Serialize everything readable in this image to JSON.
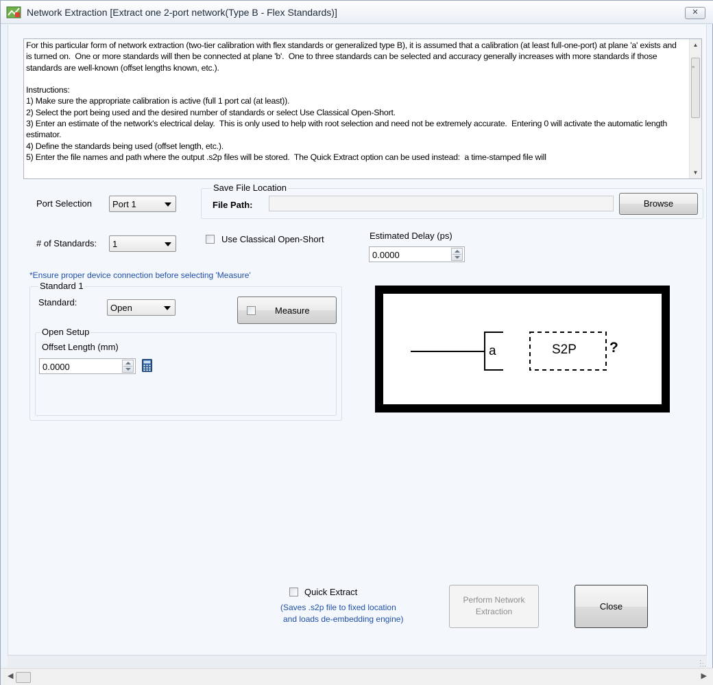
{
  "window": {
    "title": "Network Extraction [Extract one 2-port network(Type B - Flex Standards)]",
    "close_glyph": "☒"
  },
  "instructions": {
    "text": "For this particular form of network extraction (two-tier calibration with flex standards or generalized type B), it is assumed that a calibration (at least full-one-port) at plane 'a' exists and is turned on.  One or more standards will then be connected at plane 'b'.  One to three standards can be selected and accuracy generally increases with more standards if those standards are well-known (offset lengths known, etc.).\n\nInstructions:\n1) Make sure the appropriate calibration is active (full 1 port cal (at least)).\n2) Select the port being used and the desired number of standards or select Use Classical Open-Short.\n3) Enter an estimate of the network's electrical delay.  This is only used to help with root selection and need not be extremely accurate.  Entering 0 will activate the automatic length estimator.\n4) Define the standards being used (offset length, etc.).\n5) Enter the file names and path where the output .s2p files will be stored.  The Quick Extract option can be used instead:  a time-stamped file will"
  },
  "port_selection": {
    "label": "Port Selection",
    "value": "Port 1"
  },
  "save_file": {
    "group_title": "Save File Location",
    "path_label": "File Path:",
    "path_value": "",
    "browse_label": "Browse"
  },
  "num_standards": {
    "label": "# of Standards:",
    "value": "1"
  },
  "classical": {
    "label": "Use Classical Open-Short",
    "checked": false
  },
  "delay": {
    "label": "Estimated Delay (ps)",
    "value": "0.0000"
  },
  "connection_note": "*Ensure proper device connection before selecting 'Measure'",
  "standard1": {
    "group_title": "Standard 1",
    "standard_label": "Standard:",
    "standard_value": "Open",
    "measure_label": "Measure",
    "setup_title": "Open Setup",
    "offset_label": "Offset Length (mm)",
    "offset_value": "0.0000"
  },
  "diagram": {
    "plane_label": "a",
    "box_label": "S2P",
    "unknown_label": "?"
  },
  "quick_extract": {
    "label": "Quick Extract",
    "note_line1": "(Saves .s2p file to fixed location",
    "note_line2": "and loads de-embedding engine)",
    "checked": false
  },
  "perform": {
    "line1": "Perform Network",
    "line2": "Extraction"
  },
  "close_label": "Close",
  "colors": {
    "note_blue": "#1f4ea8",
    "window_bg": "#f4f8fc"
  }
}
